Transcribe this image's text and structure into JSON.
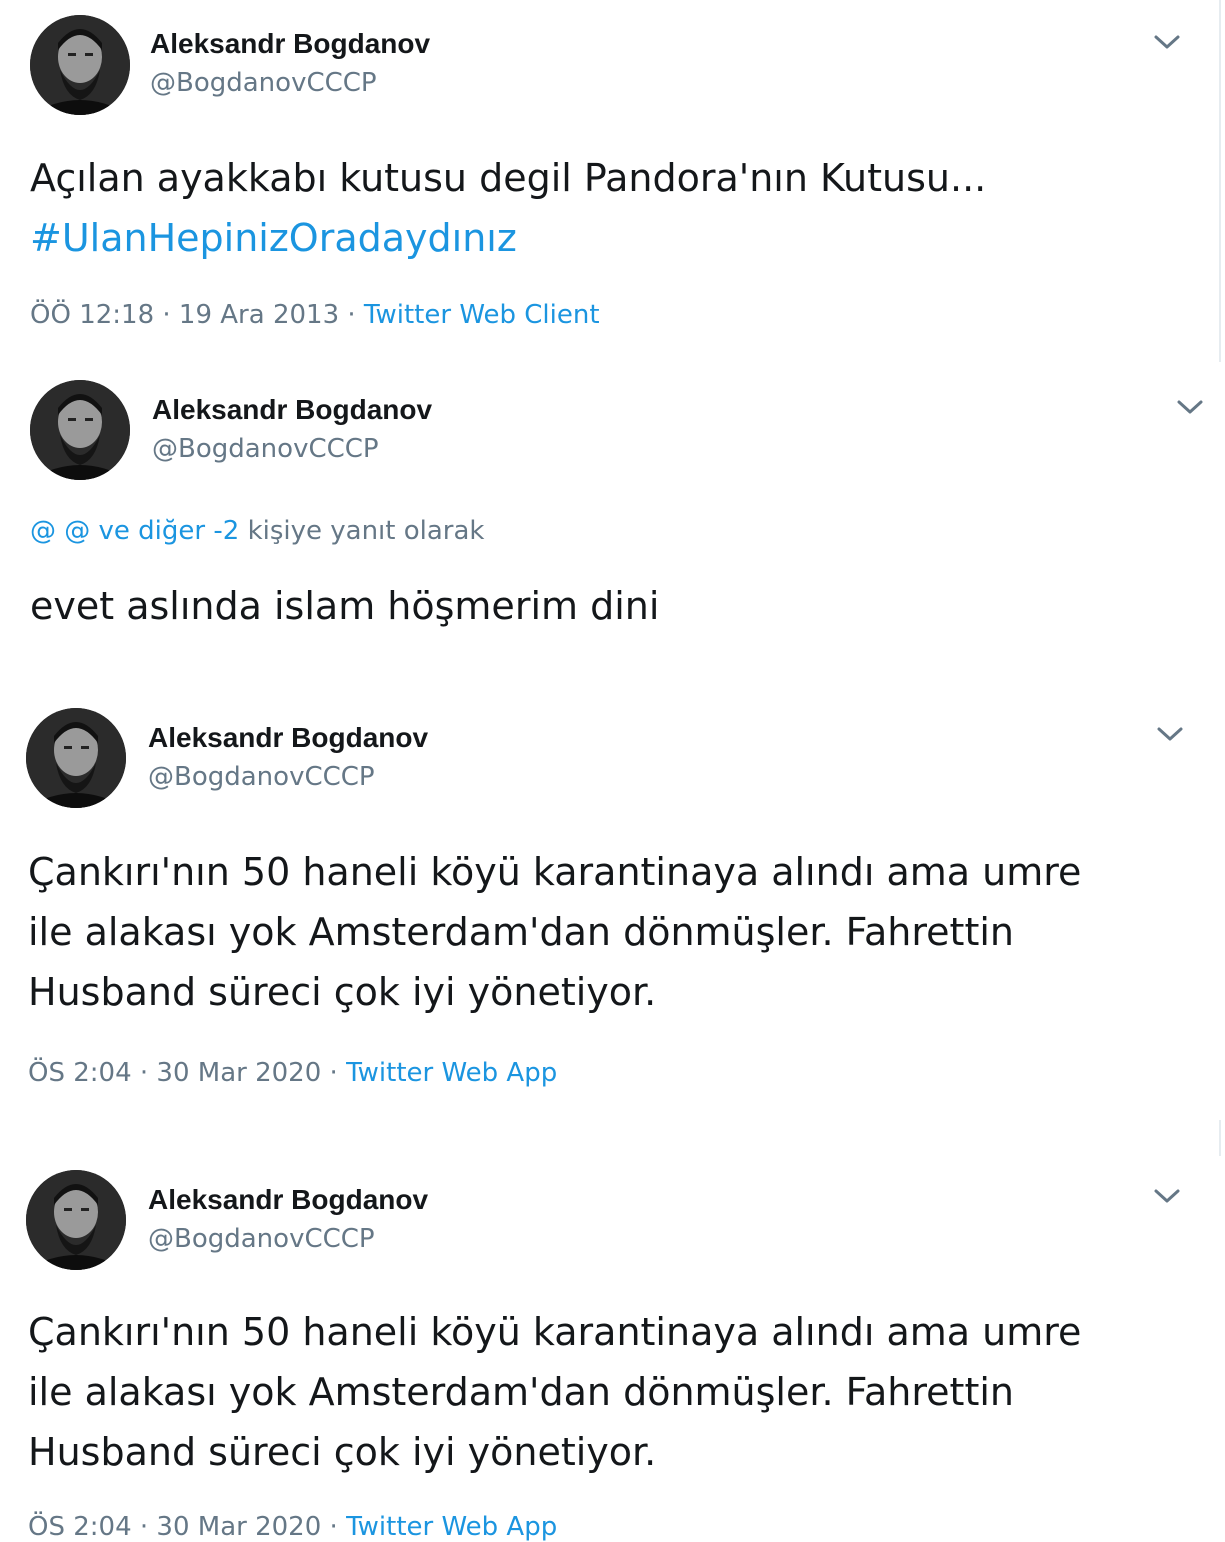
{
  "tweets": [
    {
      "name": "Aleksandr Bogdanov",
      "handle": "@BogdanovCCCP",
      "text": "Açılan ayakkabı kutusu degil Pandora'nın Kutusu...",
      "hashtag": "#UlanHepinizOradaydınız",
      "time": "ÖÖ 12:18",
      "date": "19 Ara 2013",
      "source": "Twitter Web Client",
      "separator": "·",
      "menu_icon": "chevron-down-icon"
    },
    {
      "name": "Aleksandr Bogdanov",
      "handle": "@BogdanovCCCP",
      "reply_mentions": "@ @ ve diğer -2",
      "reply_suffix": "kişiye yanıt olarak",
      "text": "evet aslında islam höşmerim dini",
      "menu_icon": "chevron-down-icon"
    },
    {
      "name": "Aleksandr Bogdanov",
      "handle": "@BogdanovCCCP",
      "lines": [
        "Çankırı'nın 50 haneli köyü karantinaya alındı ama umre",
        "ile alakası yok Amsterdam'dan dönmüşler. Fahrettin",
        "Husband süreci çok iyi yönetiyor."
      ],
      "time": "ÖS 2:04",
      "date": "30 Mar 2020",
      "source": "Twitter Web App",
      "separator": "·",
      "menu_icon": "chevron-down-icon"
    },
    {
      "name": "Aleksandr Bogdanov",
      "handle": "@BogdanovCCCP",
      "lines": [
        "Çankırı'nın 50 haneli köyü karantinaya alındı ama umre",
        "ile alakası yok Amsterdam'dan dönmüşler. Fahrettin",
        "Husband süreci çok iyi yönetiyor."
      ],
      "time": "ÖS 2:04",
      "date": "30 Mar 2020",
      "source": "Twitter Web App",
      "separator": "·",
      "menu_icon": "chevron-down-icon"
    }
  ]
}
